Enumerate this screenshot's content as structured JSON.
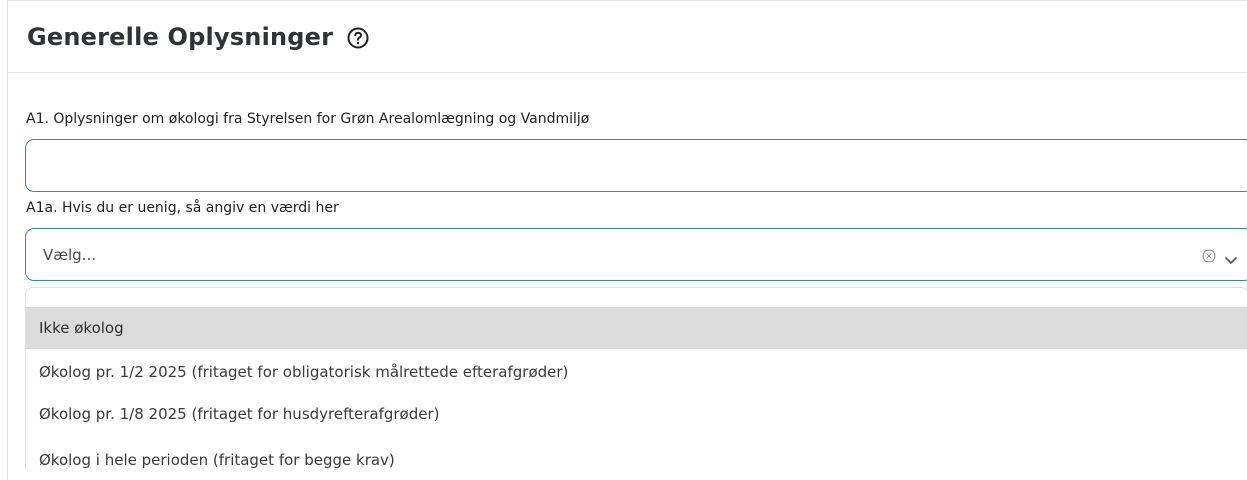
{
  "header": {
    "title": "Generelle Oplysninger",
    "help_icon": "help-circle-icon"
  },
  "fields": {
    "a1": {
      "label": "A1. Oplysninger om økologi fra Styrelsen for Grøn Arealomlægning og Vandmiljø",
      "value": ""
    },
    "a1a": {
      "label": "A1a. Hvis du er uenig, så angiv en værdi her",
      "placeholder": "Vælg...",
      "clear_icon": "clear-circle-icon",
      "chevron_icon": "chevron-down-icon"
    }
  },
  "dropdown": {
    "options": [
      {
        "label": "Ikke økolog"
      },
      {
        "label": "Økolog pr. 1/2 2025 (fritaget for obligatorisk målrettede efterafgrøder)"
      },
      {
        "label": "Økolog pr. 1/8 2025 (fritaget for husdyrefterafgrøder)"
      },
      {
        "label": "Økolog i hele perioden (fritaget for begge krav)"
      }
    ]
  },
  "colors": {
    "field_border": "#3b8e8f",
    "hovered_option_background": "#dbdbdb",
    "heading": "#2f3237"
  }
}
